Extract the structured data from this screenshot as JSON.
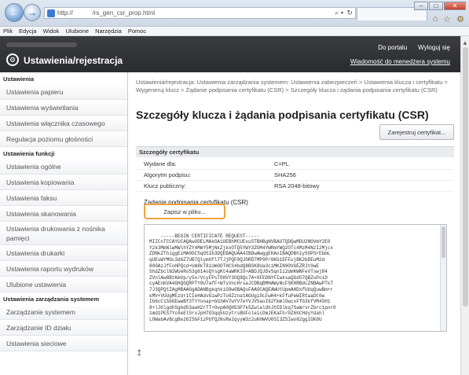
{
  "browser": {
    "address_text": "http://           /rs_gen_csr_prop.html",
    "address_tools": [
      "⌕ ▾",
      "↻"
    ],
    "window_min": "–",
    "window_max": "□",
    "window_close": "✕",
    "chrome_icons": [
      "⌂",
      "☆",
      "⚙"
    ]
  },
  "menu": [
    "Plik",
    "Edycja",
    "Widok",
    "Ulubione",
    "Narzędzia",
    "Pomoc"
  ],
  "header": {
    "title": "Ustawienia/rejestracja",
    "icon_glyph": "⚙",
    "portal_link": "Do portalu",
    "logout_link": "Wyloguj się",
    "maintenance_link": "Wiadomość do menedżera systemu"
  },
  "sidebar": {
    "section1": "Ustawienia",
    "items1": [
      "Ustawienia papieru",
      "Ustawienia wyświetlania",
      "Ustawienia włącznika czasowego",
      "Regulacja poziomu głośności"
    ],
    "section2": "Ustawienia funkcji",
    "items2": [
      "Ustawienia ogólne",
      "Ustawienia kopiowania",
      "Ustawienia faksu",
      "Ustawienia skanowania",
      "Ustawienia drukowania z nośnika pamięci",
      "Ustawienia drukarki",
      "Ustawienia raportu wydruków",
      "Ulubione ustawienia"
    ],
    "section3": "Ustawienia zarządzania systemem",
    "items3": [
      "Zarządzanie systemem",
      "Zarządzanie ID działu",
      "Ustawienia sieciowe"
    ]
  },
  "main": {
    "breadcrumb": "Ustawienia/rejestracja: Ustawienia zarządzania systemem: Ustawienia zabezpieczeń > Ustawienia klucza i certyfikatu > Wygeneruj klucz > Żądanie podpisania certyfikatu (CSR) > Szczegóły klucza i żądania podpisania certyfikatu (CSR)",
    "title": "Szczegóły klucza i żądania podpisania certyfikatu (CSR)",
    "register_button": "Zarejestruj certyfikat...",
    "section_title": "Szczegóły certyfikatu",
    "details": [
      {
        "key": "Wydane dla:",
        "value": "C=PL"
      },
      {
        "key": "Algorytm podpisu:",
        "value": "SHA256"
      },
      {
        "key": "Klucz publiczny:",
        "value": "RSA 2048-bitowy"
      }
    ],
    "csr_label": "Żądanie podpisania certyfikatu (CSR)",
    "save_button": "Zapisz w pliku...",
    "csr_text": "-----BEGIN CERTIFICATE REQUEST-----\nMIICnTCCAYUCAQAwUDELMAkGA1UEBhMCUExuSTBHBgNVBAUTQDQwMDU2NGVmY2E0\nY2k3MmNlwMWlhYZY4MmY5MjNkZjkxOTQ5YWY3ZGM4YWRmYWQ2OTc4MzM4NzI2Mjcx\nZDNkZThiggEiMA0GCSqGSIb3DQEBAQUAA4IBDwAwggEKAoIBAQDBh1y5OPSrEbmL\nqUEsWYMGc3d6Z7UB7QlymUfl7TJjPQF0QJORD7MP9P/6KG1EFFujBK2bDEuM2d\n80GAzJfFoHPQcd+Um8kT8iUmOOTHCS4bdQ8BSK8Ua3c1MKIN9OVUEZRJt0wE\nShdZbclN2WUeRoS3g614oQYsgKt4aWRKIO+ABDJQJDvSqnIi2dmKWNFeVTswj84\nZVnlAw8BtKmVp/y5x/VcyFPsT08VY3OQ8Qc7A+8FEDNYFIwksaQGd57QBZuPoiD\ncyAEnKVA4GHQGQRPTY8U7afF+W7sVncHrsaJCDBqBMHAWyNcFSKHRBdcZNBAwPTkT\n7J3QPQtZAgMBAAGgADANBgkqhkiG9w0BAQsFAAOCAQEAWUtUpmAHDxfUUqQuwBm+r\nkMV+VUUgMEzUr1CIeHAdvGiwPzTo0ZznatAGUgi0LFwH4+kFfuPeWIRtaaDt0w\nIb6cC15bGEwwBf3TYYonap+bG3AV7wYV7eYVJV5aoI62fmml5wcxFfG3kfVM4SH1\n8+lJGlgdhSgbd53awH2rTT+OvpA0QH53P7k5ZwlaldhJtEDlkq7SaW/vrZbrc1pnr0\n1md1PES7Yc0eElSroJpH7G3qq5UzytrsBUFoleicDmJEKaFh/0Z6hCHdyYdahl\nLOWabAvBcgBe2GI5bF1zPUfQ2NsRe2qyyW3z2uKHWVU0SI3Z5Iwo82ggIGK0U"
  }
}
